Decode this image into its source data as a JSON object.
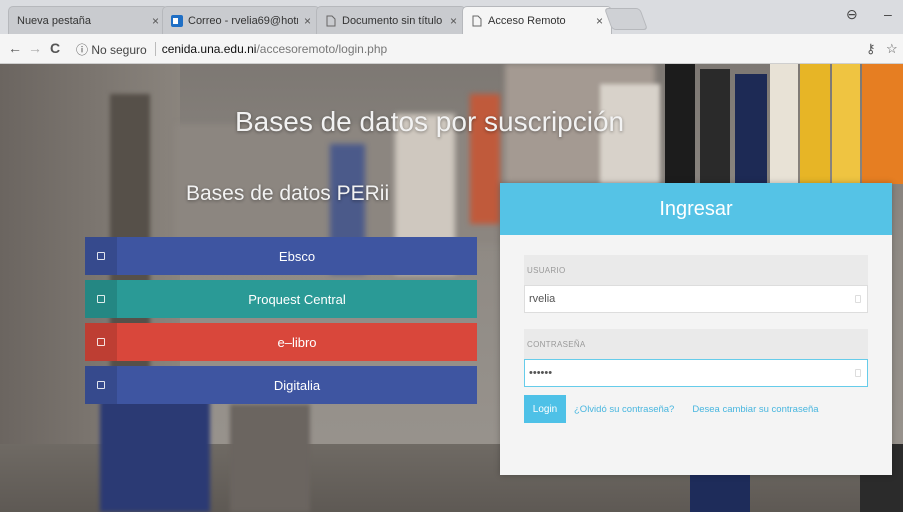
{
  "browser": {
    "tabs": [
      {
        "title": "Nueva pestaña",
        "close": "×",
        "active": false
      },
      {
        "title": "Correo - rvelia69@hotm",
        "close": "×",
        "active": false
      },
      {
        "title": "Documento sin título",
        "close": "×",
        "active": false
      },
      {
        "title": "Acceso Remoto",
        "close": "×",
        "active": true
      }
    ],
    "profile_glyph": "⊖",
    "minimize_glyph": "–",
    "back_glyph": "←",
    "forward_glyph": "→",
    "reload_glyph": "C",
    "security": "ⓘ No seguro",
    "url_host": "cenida.una.edu.ni",
    "url_path": "/accesoremoto/login.php",
    "key_glyph": "⚷",
    "star_glyph": "☆"
  },
  "page": {
    "heading": "Bases de datos por suscripción",
    "subheading": "Bases de datos PERii",
    "databases": [
      {
        "label": "Ebsco",
        "color": "#3e55a1"
      },
      {
        "label": "Proquest Central",
        "color": "#2a9a96"
      },
      {
        "label": "e–libro",
        "color": "#d9473b"
      },
      {
        "label": "Digitalia",
        "color": "#3e55a1"
      }
    ]
  },
  "login": {
    "title": "Ingresar",
    "user_label": "USUARIO",
    "user_value": "rvelia",
    "password_label": "CONTRASEÑA",
    "password_value": "••••••",
    "button": "Login",
    "forgot_link": "¿Olvidó su contraseña?",
    "change_link": "Desea cambiar su contraseña"
  },
  "colors": {
    "accent": "#55c3e6",
    "ebsco": "#3e55a1",
    "proquest": "#2a9a96",
    "elibro": "#d9473b"
  }
}
